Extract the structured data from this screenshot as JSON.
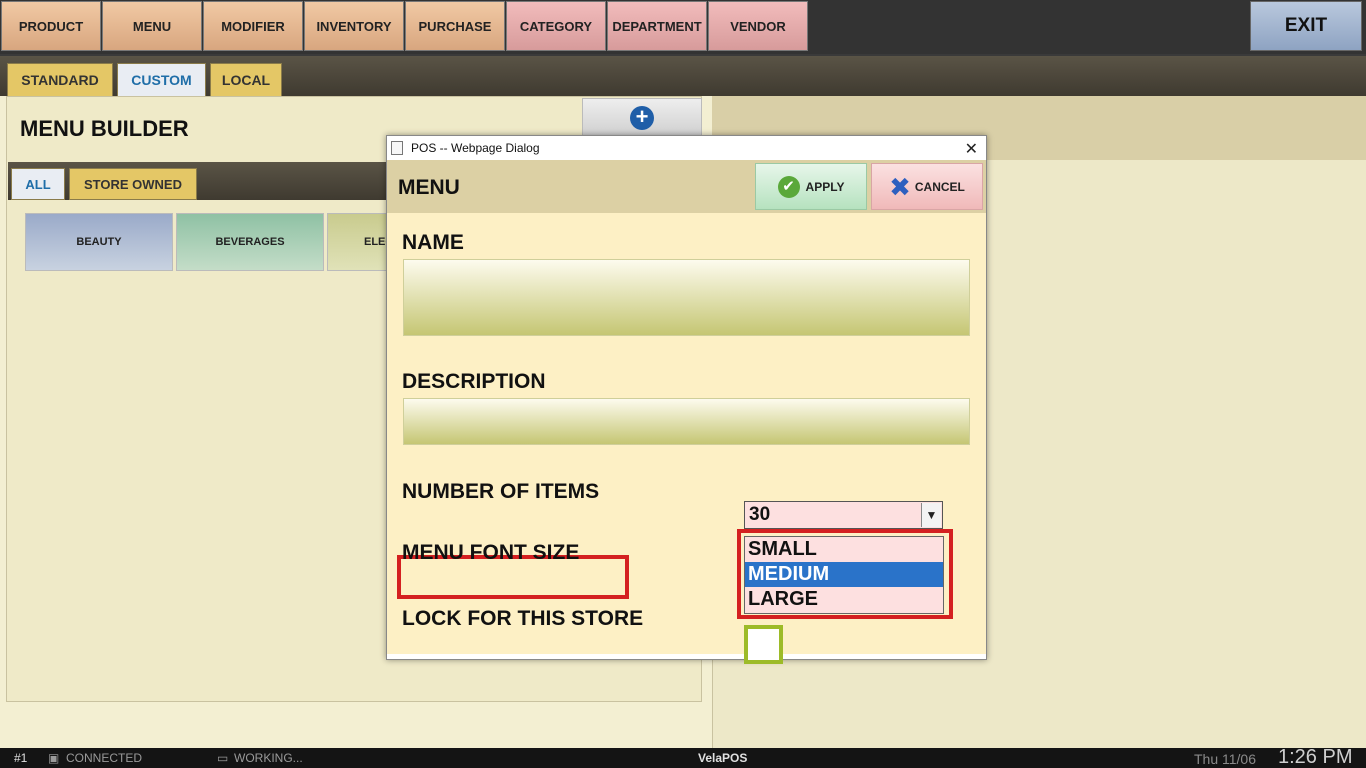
{
  "top_nav": {
    "items": [
      {
        "label": "PRODUCT"
      },
      {
        "label": "MENU"
      },
      {
        "label": "MODIFIER"
      },
      {
        "label": "INVENTORY"
      },
      {
        "label": "PURCHASE"
      },
      {
        "label": "CATEGORY"
      },
      {
        "label": "DEPARTMENT"
      },
      {
        "label": "VENDOR"
      }
    ],
    "exit_label": "EXIT"
  },
  "tabs": {
    "standard": "STANDARD",
    "custom": "CUSTOM",
    "local": "LOCAL",
    "active": "CUSTOM"
  },
  "menu_builder": {
    "title": "MENU BUILDER",
    "add_icon": "plus-circle-icon",
    "subtabs": {
      "all": "ALL",
      "store_owned": "STORE OWNED",
      "active": "ALL"
    },
    "categories": [
      {
        "label": "BEAUTY"
      },
      {
        "label": "BEVERAGES"
      },
      {
        "label": "ELEC"
      }
    ]
  },
  "dialog": {
    "window_title": "POS -- Webpage Dialog",
    "close_glyph": "✕",
    "heading": "MENU",
    "apply_label": "APPLY",
    "cancel_label": "CANCEL",
    "name_label": "NAME",
    "name_value": "",
    "description_label": "DESCRIPTION",
    "description_value": "",
    "number_of_items_label": "NUMBER OF ITEMS",
    "number_of_items_value": "30",
    "menu_font_size_label": "MENU FONT SIZE",
    "font_size_options": [
      "SMALL",
      "MEDIUM",
      "LARGE"
    ],
    "font_size_highlighted": "MEDIUM",
    "lock_label": "LOCK FOR THIS STORE",
    "lock_checked": false
  },
  "status_bar": {
    "terminal": "#1",
    "connection": "CONNECTED",
    "activity": "WORKING...",
    "brand": "VelaPOS",
    "date": "Thu 11/06",
    "time": "1:26 PM"
  },
  "colors": {
    "accent_blue": "#1f6ea8",
    "highlight_red": "#d42020",
    "selection_blue": "#2a73c9",
    "checkbox_green": "#9dbb28"
  }
}
